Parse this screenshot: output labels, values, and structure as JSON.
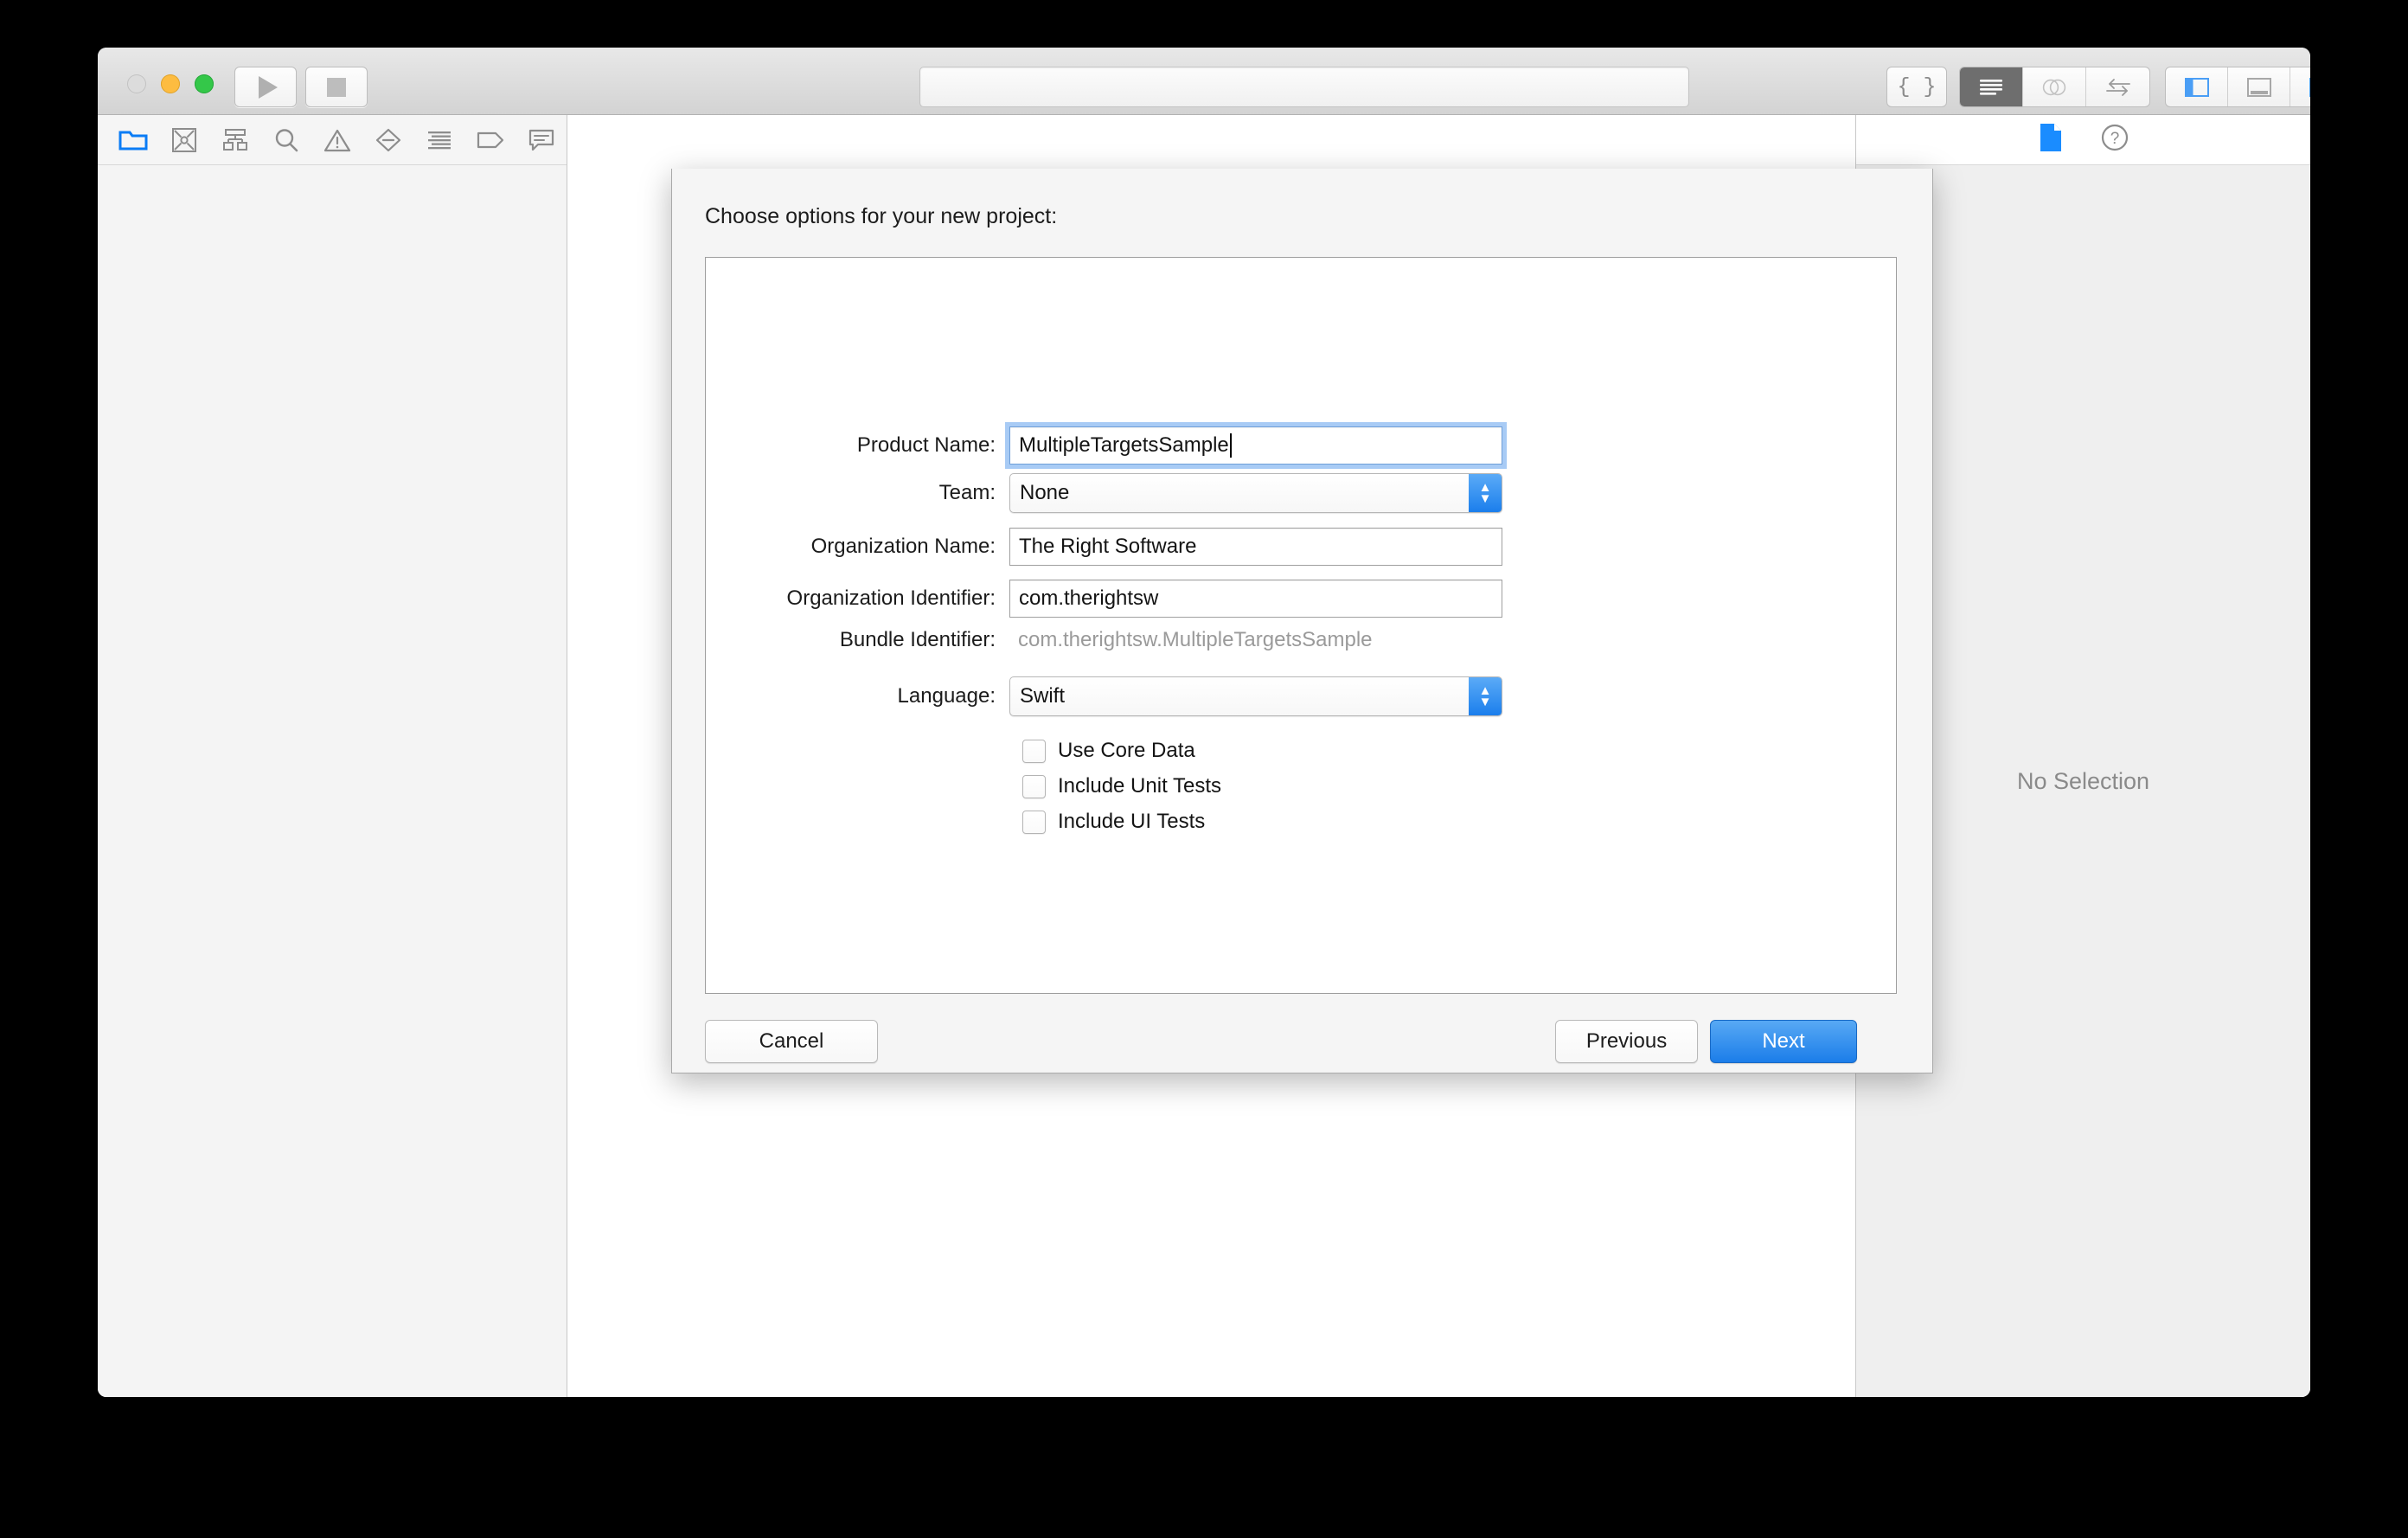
{
  "window": {
    "traffic_lights": [
      "close",
      "minimize",
      "zoom"
    ],
    "toolbar": {
      "run_label": "Run",
      "stop_label": "Stop",
      "status_field_value": "",
      "status_field_placeholder": "",
      "library_button": "{ }",
      "editor_segment": [
        {
          "name": "standard-editor",
          "active": true
        },
        {
          "name": "assistant-editor",
          "active": false
        },
        {
          "name": "version-editor",
          "active": false
        }
      ],
      "view_segment": [
        {
          "name": "navigator-toggle",
          "active": true
        },
        {
          "name": "debug-area-toggle",
          "active": false
        },
        {
          "name": "inspector-toggle",
          "active": true
        }
      ]
    }
  },
  "navigator": {
    "tabs": [
      {
        "name": "project-navigator",
        "active": true
      },
      {
        "name": "source-control-navigator",
        "active": false
      },
      {
        "name": "symbol-navigator",
        "active": false
      },
      {
        "name": "find-navigator",
        "active": false
      },
      {
        "name": "issue-navigator",
        "active": false
      },
      {
        "name": "test-navigator",
        "active": false
      },
      {
        "name": "debug-navigator",
        "active": false
      },
      {
        "name": "breakpoint-navigator",
        "active": false
      },
      {
        "name": "report-navigator",
        "active": false
      }
    ]
  },
  "inspector": {
    "tabs": [
      {
        "name": "file-inspector",
        "active": true
      },
      {
        "name": "quick-help-inspector",
        "active": false
      }
    ],
    "empty_state": "No Selection"
  },
  "sheet": {
    "title": "Choose options for your new project:",
    "fields": [
      {
        "label": "Product Name:",
        "value": "MultipleTargetsSample",
        "type": "text",
        "focused": true
      },
      {
        "label": "Team:",
        "value": "None",
        "type": "popup",
        "focused": false
      },
      {
        "label": "Organization Name:",
        "value": "The Right Software",
        "type": "text",
        "focused": false
      },
      {
        "label": "Organization Identifier:",
        "value": "com.therightsw",
        "type": "text",
        "focused": false
      },
      {
        "label": "Bundle Identifier:",
        "value": "com.therightsw.MultipleTargetsSample",
        "type": "static",
        "focused": false
      },
      {
        "label": "Language:",
        "value": "Swift",
        "type": "popup",
        "focused": false
      }
    ],
    "checkboxes": [
      {
        "label": "Use Core Data",
        "checked": false
      },
      {
        "label": "Include Unit Tests",
        "checked": false
      },
      {
        "label": "Include UI Tests",
        "checked": false
      }
    ],
    "buttons": {
      "cancel": "Cancel",
      "previous": "Previous",
      "next": "Next"
    }
  },
  "colors": {
    "accent_blue": "#1b7de9",
    "focus_ring": "#a8cbf5",
    "active_tab": "#0a7cf5",
    "muted_text": "#9a9a9a"
  }
}
